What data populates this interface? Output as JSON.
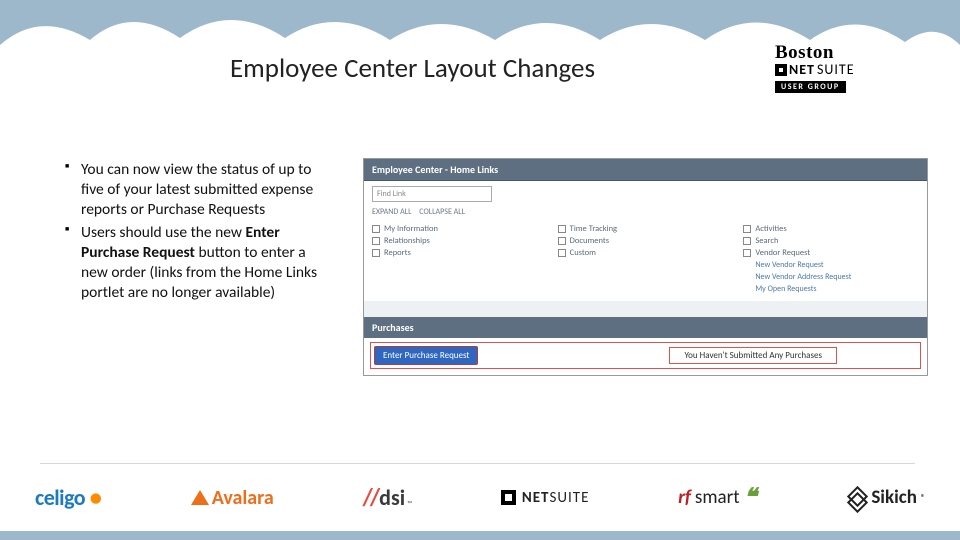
{
  "title": "Employee Center Layout Changes",
  "badge": {
    "line1": "Boston",
    "line2a": "NET",
    "line2b": "SUITE",
    "line3": "USER GROUP"
  },
  "bullets": [
    {
      "pre": "You can now view the status of up to five of your latest submitted expense reports or Purchase Requests",
      "bold": "",
      "post": ""
    },
    {
      "pre": "Users should use the new ",
      "bold": "Enter Purchase Request",
      "post": " button to enter a new order (links from the Home Links portlet are no longer available)"
    }
  ],
  "shot": {
    "header": "Employee Center - Home Links",
    "search_placeholder": "Find Link",
    "expand": "EXPAND ALL",
    "collapse": "COLLAPSE ALL",
    "col1": [
      "My Information",
      "Relationships",
      "Reports"
    ],
    "col2": [
      "Time Tracking",
      "Documents",
      "Custom"
    ],
    "col3_main": [
      "Activities",
      "Search",
      "Vendor Request"
    ],
    "col3_sub": [
      "New Vendor Request",
      "New Vendor Address Request",
      "My Open Requests"
    ],
    "purch_header": "Purchases",
    "purch_btn": "Enter Purchase Request",
    "purch_msg": "You Haven't Submitted Any Purchases"
  },
  "logos": {
    "celigo": "celigo",
    "avalara": "Avalara",
    "dsi": "dsi",
    "netsuite_a": "NET",
    "netsuite_b": "SUITE",
    "rfsmart_a": "rf",
    "rfsmart_b": "smart",
    "sikich": "Sikich"
  }
}
